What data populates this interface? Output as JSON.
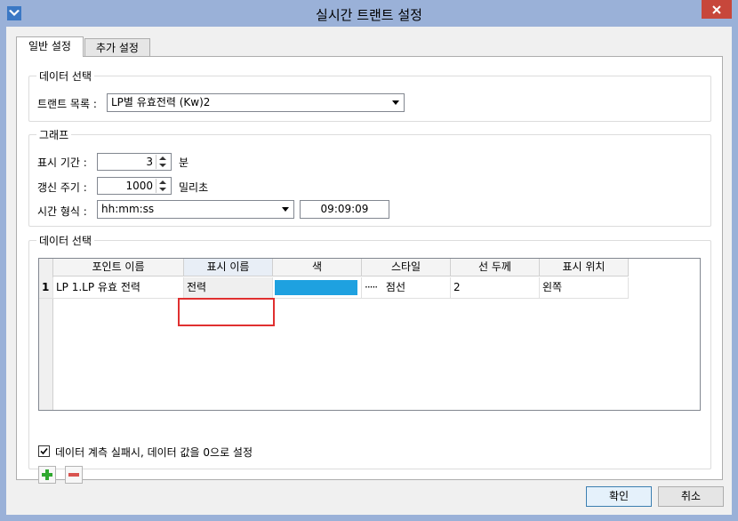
{
  "window": {
    "title": "실시간 트랜트 설정"
  },
  "tabs": [
    {
      "label": "일반 설정",
      "active": true
    },
    {
      "label": "추가 설정",
      "active": false
    }
  ],
  "data_select": {
    "title": "데이터 선택",
    "trend_list_label": "트랜트 목록 :",
    "trend_list_value": "LP별 유효전력 (Kw)2"
  },
  "graph": {
    "title": "그래프",
    "period_label": "표시 기간 :",
    "period_value": "3",
    "period_unit": "분",
    "refresh_label": "갱신 주기 :",
    "refresh_value": "1000",
    "refresh_unit": "밀리초",
    "time_format_label": "시간 형식 :",
    "time_format_value": "hh:mm:ss",
    "time_preview": "09:09:09"
  },
  "data_table": {
    "title": "데이터 선택",
    "columns": [
      "포인트 이름",
      "표시 이름",
      "색",
      "스타일",
      "선 두께",
      "표시 위치"
    ],
    "rows": [
      {
        "index": "1",
        "point_name": "LP 1.LP 유효 전력",
        "display_name": "전력",
        "color": "#1ea1e0",
        "style_glyph": "·····",
        "style": "점선",
        "line_width": "2",
        "position": "왼쪽"
      }
    ]
  },
  "options": {
    "zero_on_fail_label": "데이터 계측 실패시, 데이터 값을 0으로 설정",
    "zero_on_fail_checked": true
  },
  "footer": {
    "ok_label": "확인",
    "cancel_label": "취소"
  },
  "icons": {
    "app": "app-icon",
    "close": "close-icon",
    "add": "plus-icon",
    "remove": "minus-icon",
    "add_color": "#2fa82f",
    "remove_color": "#d9534f"
  }
}
